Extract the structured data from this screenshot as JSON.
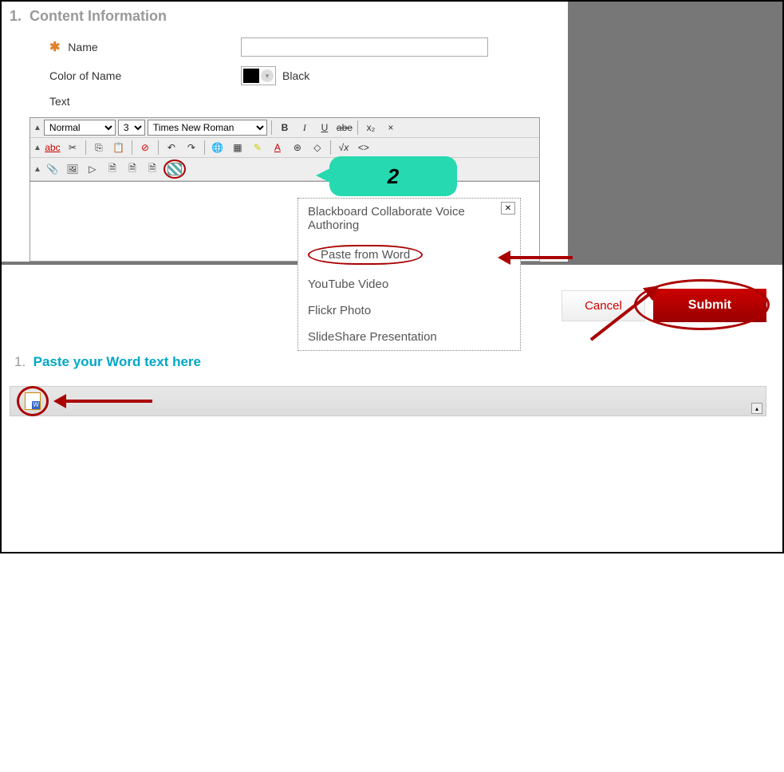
{
  "section1": {
    "number": "1.",
    "title": "Content Information",
    "name_label": "Name",
    "color_label": "Color of Name",
    "color_value": "Black",
    "text_label": "Text"
  },
  "editor": {
    "style_select": "Normal",
    "size_select": "3",
    "font_select": "Times New Roman",
    "row1_icons": [
      "B",
      "I",
      "U",
      "abe",
      "x₂"
    ],
    "row2_prefix": "abc",
    "formula": "√x"
  },
  "callout": {
    "number": "2"
  },
  "dropdown": {
    "items": [
      "Blackboard Collaborate Voice Authoring",
      "Paste from Word",
      "YouTube Video",
      "Flickr Photo",
      "SlideShare Presentation"
    ]
  },
  "bottom": {
    "cancel": "Cancel",
    "submit": "Submit",
    "section_number": "1.",
    "section_title": "Paste your Word text here"
  }
}
